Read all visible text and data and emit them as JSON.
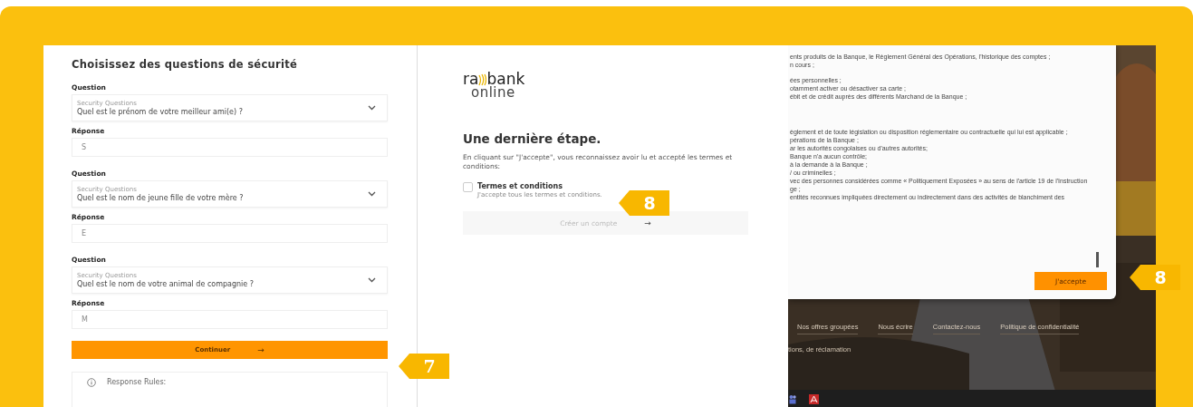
{
  "security_form": {
    "title": "Choisissez des questions de sécurité",
    "questions": [
      {
        "label": "Question",
        "placeholder": "Security Questions",
        "value": "Quel est le prénom de votre meilleur ami(e) ?",
        "answer_label": "Réponse",
        "answer": "S"
      },
      {
        "label": "Question",
        "placeholder": "Security Questions",
        "value": "Quel est le nom de jeune fille de votre mère ?",
        "answer_label": "Réponse",
        "answer": "E"
      },
      {
        "label": "Question",
        "placeholder": "Security Questions",
        "value": "Quel est le nom de votre animal de compagnie ?",
        "answer_label": "Réponse",
        "answer": "M"
      }
    ],
    "button": {
      "label": "Continuer",
      "arrow": "→"
    },
    "rules_title": "Response Rules:",
    "callout": "7"
  },
  "signup": {
    "logo": {
      "left": "ra",
      "right": "bank",
      "sub": "online"
    },
    "heading": "Une dernière étape.",
    "intro": "En cliquant sur \"J'accepte\", vous reconnaissez avoir lu et accepté les termes et conditions:",
    "checkbox": {
      "label": "Termes et conditions",
      "hint": "J'accepte tous les termes et conditions.",
      "checked": false
    },
    "button": {
      "label": "Créer un compte",
      "arrow": "→",
      "disabled": true
    },
    "callout": "8"
  },
  "terms": {
    "blocks": [
      [
        "ents produits de la Banque, le Règlement Général des Opérations, l'historique des comptes ;",
        "n cours ;"
      ],
      [
        "ées personnelles ;",
        "otamment activer ou désactiver sa carte ;",
        "ébit et de crédit auprès des différents Marchand de la Banque ;"
      ],
      [
        "èglement et de toute législation ou disposition réglementaire ou contractuelle qui lui est applicable ;",
        "pérations de la Banque ;",
        "ar les autorités congolaises ou d'autres autorités;",
        "Banque n'a aucun contrôle;",
        "à la demande à la Banque ;",
        "/ ou criminelles ;",
        "vec des personnes considérées comme « Politiquement Exposées » au sens de l'article 19 de l'Instruction",
        "ge ;",
        "entités reconnues impliquées directement ou indirectement dans des activités de blanchiment des"
      ]
    ],
    "accept_button": "J'accepte",
    "footer_links": [
      "Nos offres groupées",
      "Nous écrire",
      "Contactez-nous",
      "Politique de confidentialité"
    ],
    "footer_note": "tions, de réclamation",
    "callout": "8"
  }
}
